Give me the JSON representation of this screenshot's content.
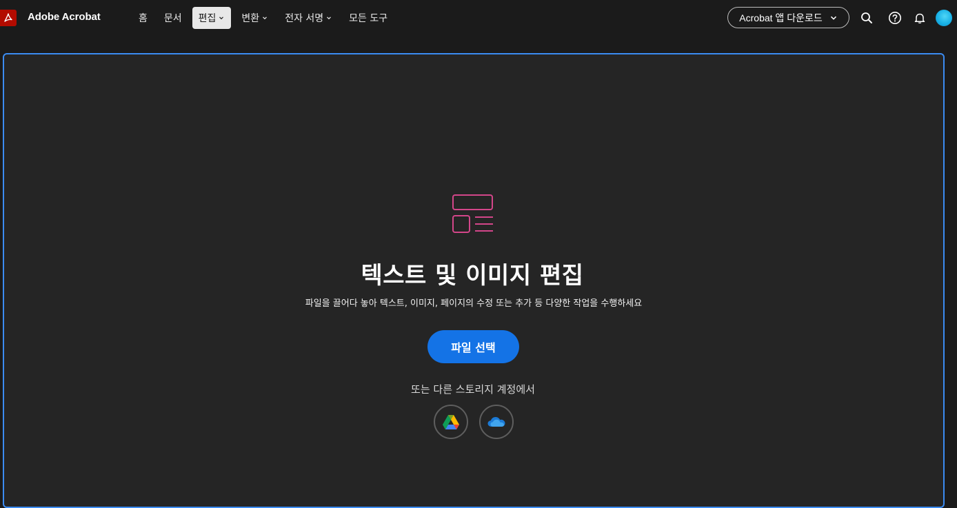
{
  "app": {
    "name": "Adobe Acrobat"
  },
  "nav": {
    "items": [
      {
        "label": "홈",
        "has_dropdown": false,
        "active": false
      },
      {
        "label": "문서",
        "has_dropdown": false,
        "active": false
      },
      {
        "label": "편집",
        "has_dropdown": true,
        "active": true
      },
      {
        "label": "변환",
        "has_dropdown": true,
        "active": false
      },
      {
        "label": "전자 서명",
        "has_dropdown": true,
        "active": false
      },
      {
        "label": "모든 도구",
        "has_dropdown": false,
        "active": false
      }
    ]
  },
  "header": {
    "download_label": "Acrobat 앱 다운로드",
    "icons": [
      "search-icon",
      "help-icon",
      "bell-icon"
    ]
  },
  "main": {
    "title": "텍스트 및 이미지 편집",
    "subtitle": "파일을 끌어다 놓아 텍스트, 이미지, 페이지의 수정 또는 추가 등 다양한 작업을 수행하세요",
    "primary_button": "파일 선택",
    "storage_label": "또는 다른 스토리지 계정에서",
    "storage_options": [
      "google-drive-icon",
      "onedrive-icon"
    ]
  },
  "colors": {
    "accent_blue": "#1473e6",
    "focus_border": "#3b8cf3",
    "hero_icon_pink": "#d4468a",
    "logo_red": "#b30b00"
  }
}
